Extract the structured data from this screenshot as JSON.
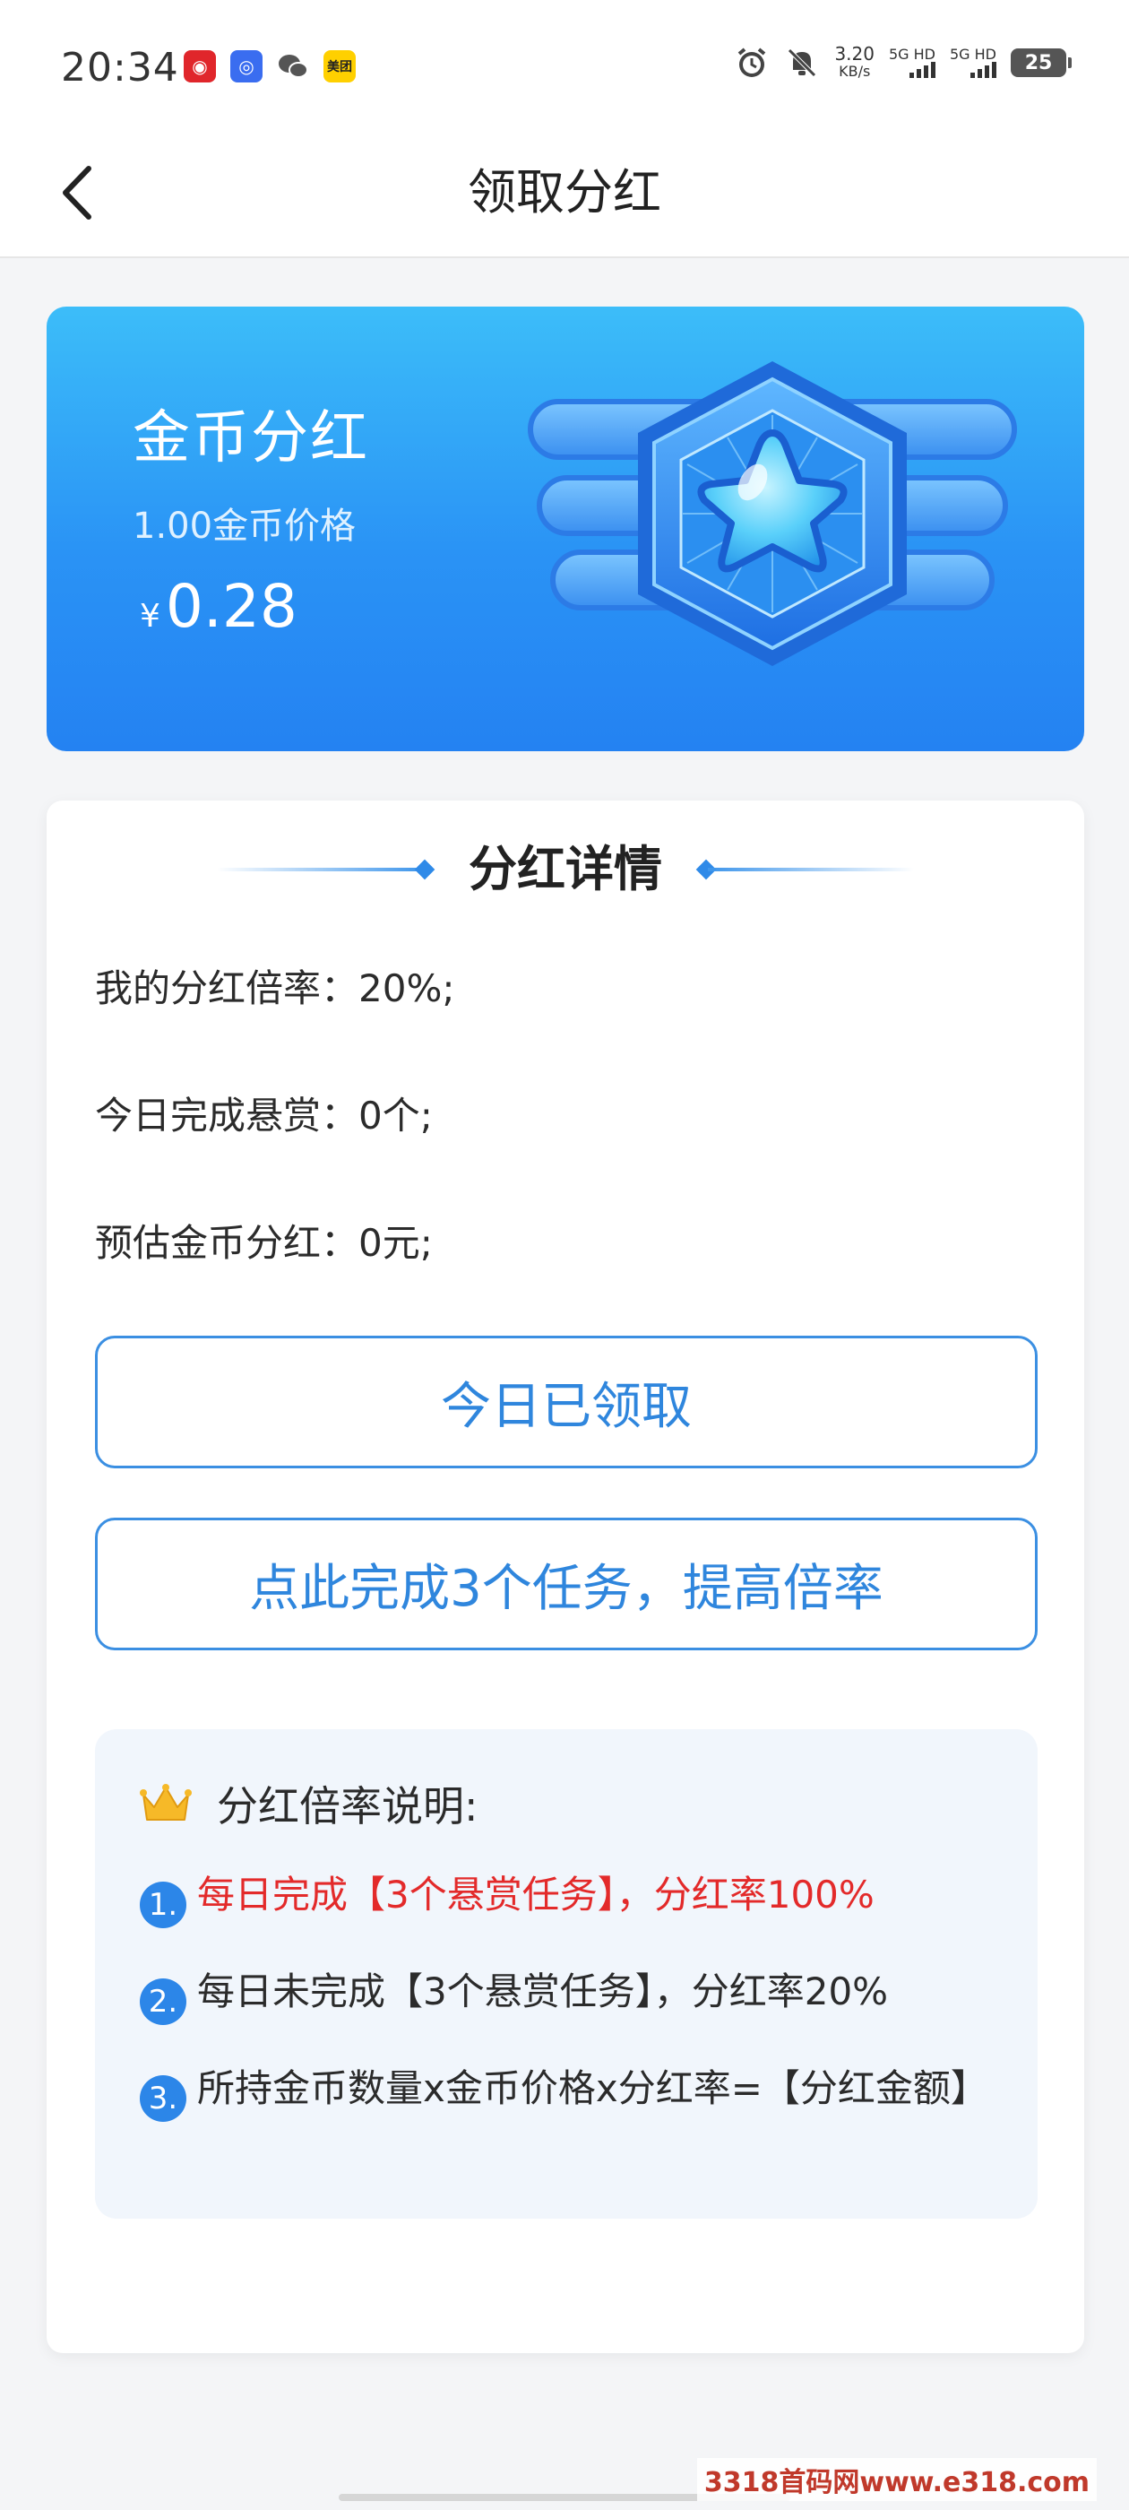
{
  "status_bar": {
    "time": "20:34",
    "net_speed_value": "3.20",
    "net_speed_unit": "KB/s",
    "signal1": "5G HD",
    "signal2": "5G HD",
    "battery": "25",
    "meituan_label": "美团"
  },
  "nav": {
    "title": "领取分红"
  },
  "hero": {
    "title": "金币分红",
    "subtitle": "1.00金币价格",
    "currency": "¥",
    "amount": "0.28"
  },
  "details": {
    "section_title": "分红详情",
    "lines": [
      "我的分红倍率：20%;",
      "今日完成悬赏：0个;",
      "预估金币分红：0元;"
    ],
    "claimed_button": "今日已领取",
    "task_button": "点此完成3个任务，提高倍率"
  },
  "rules": {
    "title": "分红倍率说明:",
    "items": [
      {
        "num": "1.",
        "part1": "每日完成【3个悬赏任务】，",
        "part2": "分红率100%"
      },
      {
        "num": "2.",
        "text": "每日未完成【3个悬赏任务】，分红率20%"
      },
      {
        "num": "3.",
        "text": "所持金币数量x金币价格x分红率=【分红金额】"
      }
    ]
  },
  "watermark": "3318首码网www.e318.com",
  "colors": {
    "accent": "#2f86dd",
    "highlight_red": "#e32a2a",
    "hero_gradient_top": "#3cbdf9",
    "hero_gradient_bottom": "#2482f2"
  }
}
